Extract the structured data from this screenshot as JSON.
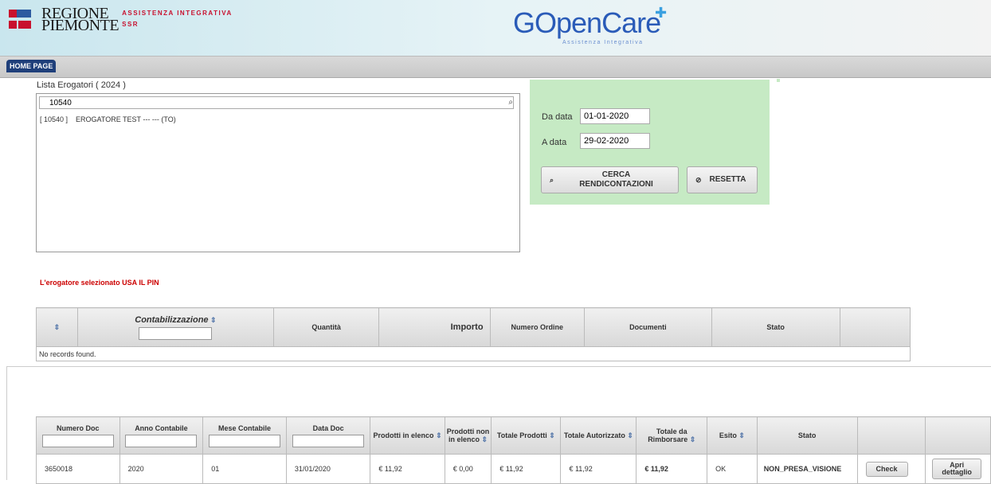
{
  "header": {
    "regione_line1": "REGIONE",
    "regione_line2": "PIEMONTE",
    "assistenza": "ASSISTENZA INTEGRATIVA",
    "ssr": "SSR",
    "app_name": "GOpen",
    "app_name2": "Care",
    "app_subtitle": "Assistenza Integrativa"
  },
  "nav": {
    "home": "HOME PAGE"
  },
  "list": {
    "label": "Lista Erogatori ( 2024 )",
    "search_value": "10540",
    "item": "[ 10540 ]    EROGATORE TEST --- --- (TO)"
  },
  "filters": {
    "from_label": "Da data",
    "from_value": "01-01-2020",
    "to_label": "A data",
    "to_value": "29-02-2020",
    "search_button": "CERCA RENDICONTAZIONI",
    "reset_button": "RESETTA"
  },
  "pin_message": "L'erogatore selezionato USA IL PIN",
  "table1": {
    "headers": [
      "Contabilizzazione",
      "Quantità",
      "Importo",
      "Numero Ordine",
      "Documenti",
      "Stato"
    ],
    "empty": "No records found."
  },
  "table2": {
    "headers": [
      "Numero Doc",
      "Anno Contabile",
      "Mese Contabile",
      "Data Doc",
      "Prodotti in elenco",
      "Prodotti non in elenco",
      "Totale Prodotti",
      "Totale Autorizzato",
      "Totale da Rimborsare",
      "Esito",
      "Stato"
    ],
    "row": {
      "numero_doc": "3650018",
      "anno": "2020",
      "mese": "01",
      "data": "31/01/2020",
      "prod_in": "€ 11,92",
      "prod_non_in": "€ 0,00",
      "tot_prod": "€ 11,92",
      "tot_aut": "€ 11,92",
      "tot_rimb": "€ 11,92",
      "esito": "OK",
      "stato": "NON_PRESA_VISIONE",
      "check": "Check",
      "apri": "Apri dettaglio"
    }
  },
  "colors": {
    "panel": "#c6eac4",
    "nav_tab": "#1f3f7a",
    "alert": "#cc0000"
  }
}
